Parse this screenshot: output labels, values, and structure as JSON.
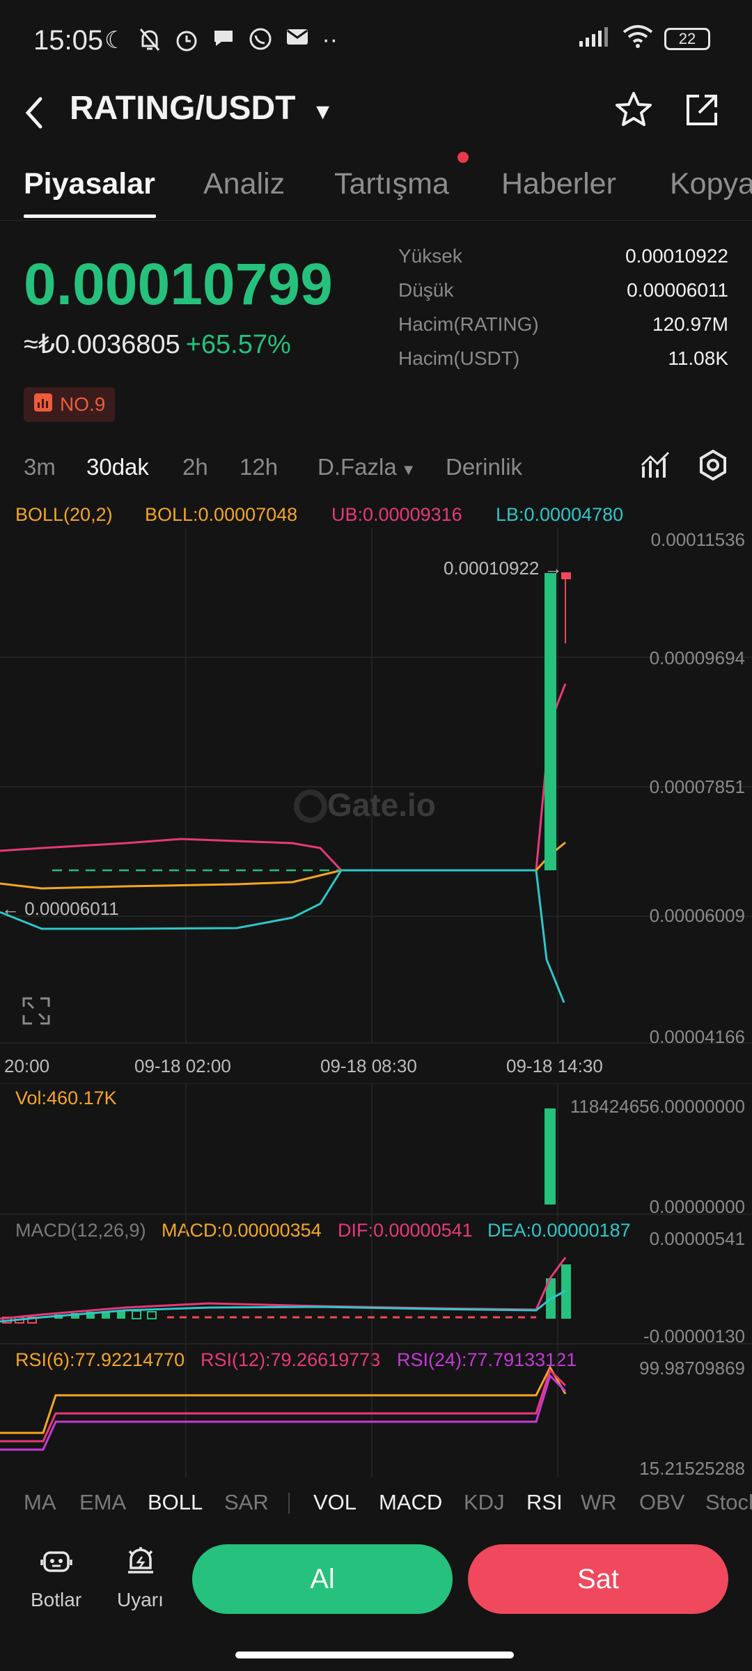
{
  "status_bar": {
    "time": "15:05",
    "battery": "22"
  },
  "header": {
    "pair": "RATING/USDT"
  },
  "tabs": [
    {
      "label": "Piyasalar"
    },
    {
      "label": "Analiz"
    },
    {
      "label": "Tartışma"
    },
    {
      "label": "Haberler"
    },
    {
      "label": "Kopya"
    }
  ],
  "price": {
    "last": "0.00010799",
    "fiat": "≈₺0.0036805",
    "change": "+65.57%",
    "rank": "NO.9"
  },
  "stats": [
    {
      "label": "Yüksek",
      "value": "0.00010922"
    },
    {
      "label": "Düşük",
      "value": "0.00006011"
    },
    {
      "label": "Hacim(RATING)",
      "value": "120.97M"
    },
    {
      "label": "Hacim(USDT)",
      "value": "11.08K"
    }
  ],
  "intervals": [
    "3m",
    "30dak",
    "2h",
    "12h",
    "D.Fazla",
    "Derinlik"
  ],
  "boll": {
    "name": "BOLL(20,2)",
    "mid": "BOLL:0.00007048",
    "ub": "UB:0.00009316",
    "lb": "LB:0.00004780"
  },
  "price_axis": [
    "0.00011536",
    "0.00009694",
    "0.00007851",
    "0.00006009",
    "0.00004166"
  ],
  "markers": {
    "high": "0.00010922",
    "low": "0.00006011"
  },
  "watermark": "Gate.io",
  "time_axis": [
    "20:00",
    "09-18 02:00",
    "09-18 08:30",
    "09-18 14:30"
  ],
  "volume": {
    "legend": "Vol:460.17K",
    "max": "118424656.00000000",
    "min": "0.00000000"
  },
  "macd": {
    "name": "MACD(12,26,9)",
    "macd": "MACD:0.00000354",
    "dif": "DIF:0.00000541",
    "dea": "DEA:0.00000187",
    "max": "0.00000541",
    "min": "-0.00000130"
  },
  "rsi": {
    "rsi6": "RSI(6):77.92214770",
    "rsi12": "RSI(12):79.26619773",
    "rsi24": "RSI(24):77.79133121",
    "max": "99.98709869",
    "min": "15.21525288"
  },
  "indicator_tabs": [
    "MA",
    "EMA",
    "BOLL",
    "SAR",
    "VOL",
    "MACD",
    "KDJ",
    "RSI",
    "WR",
    "OBV",
    "Stoch"
  ],
  "bottom": {
    "bots": "Botlar",
    "alert": "Uyarı",
    "buy": "Al",
    "sell": "Sat"
  },
  "colors": {
    "green": "#26c17c",
    "red": "#f0485c",
    "boll": "#f5a623",
    "ub": "#e8397a",
    "lb": "#2ec7c9",
    "rsi24": "#c43ad8"
  }
}
